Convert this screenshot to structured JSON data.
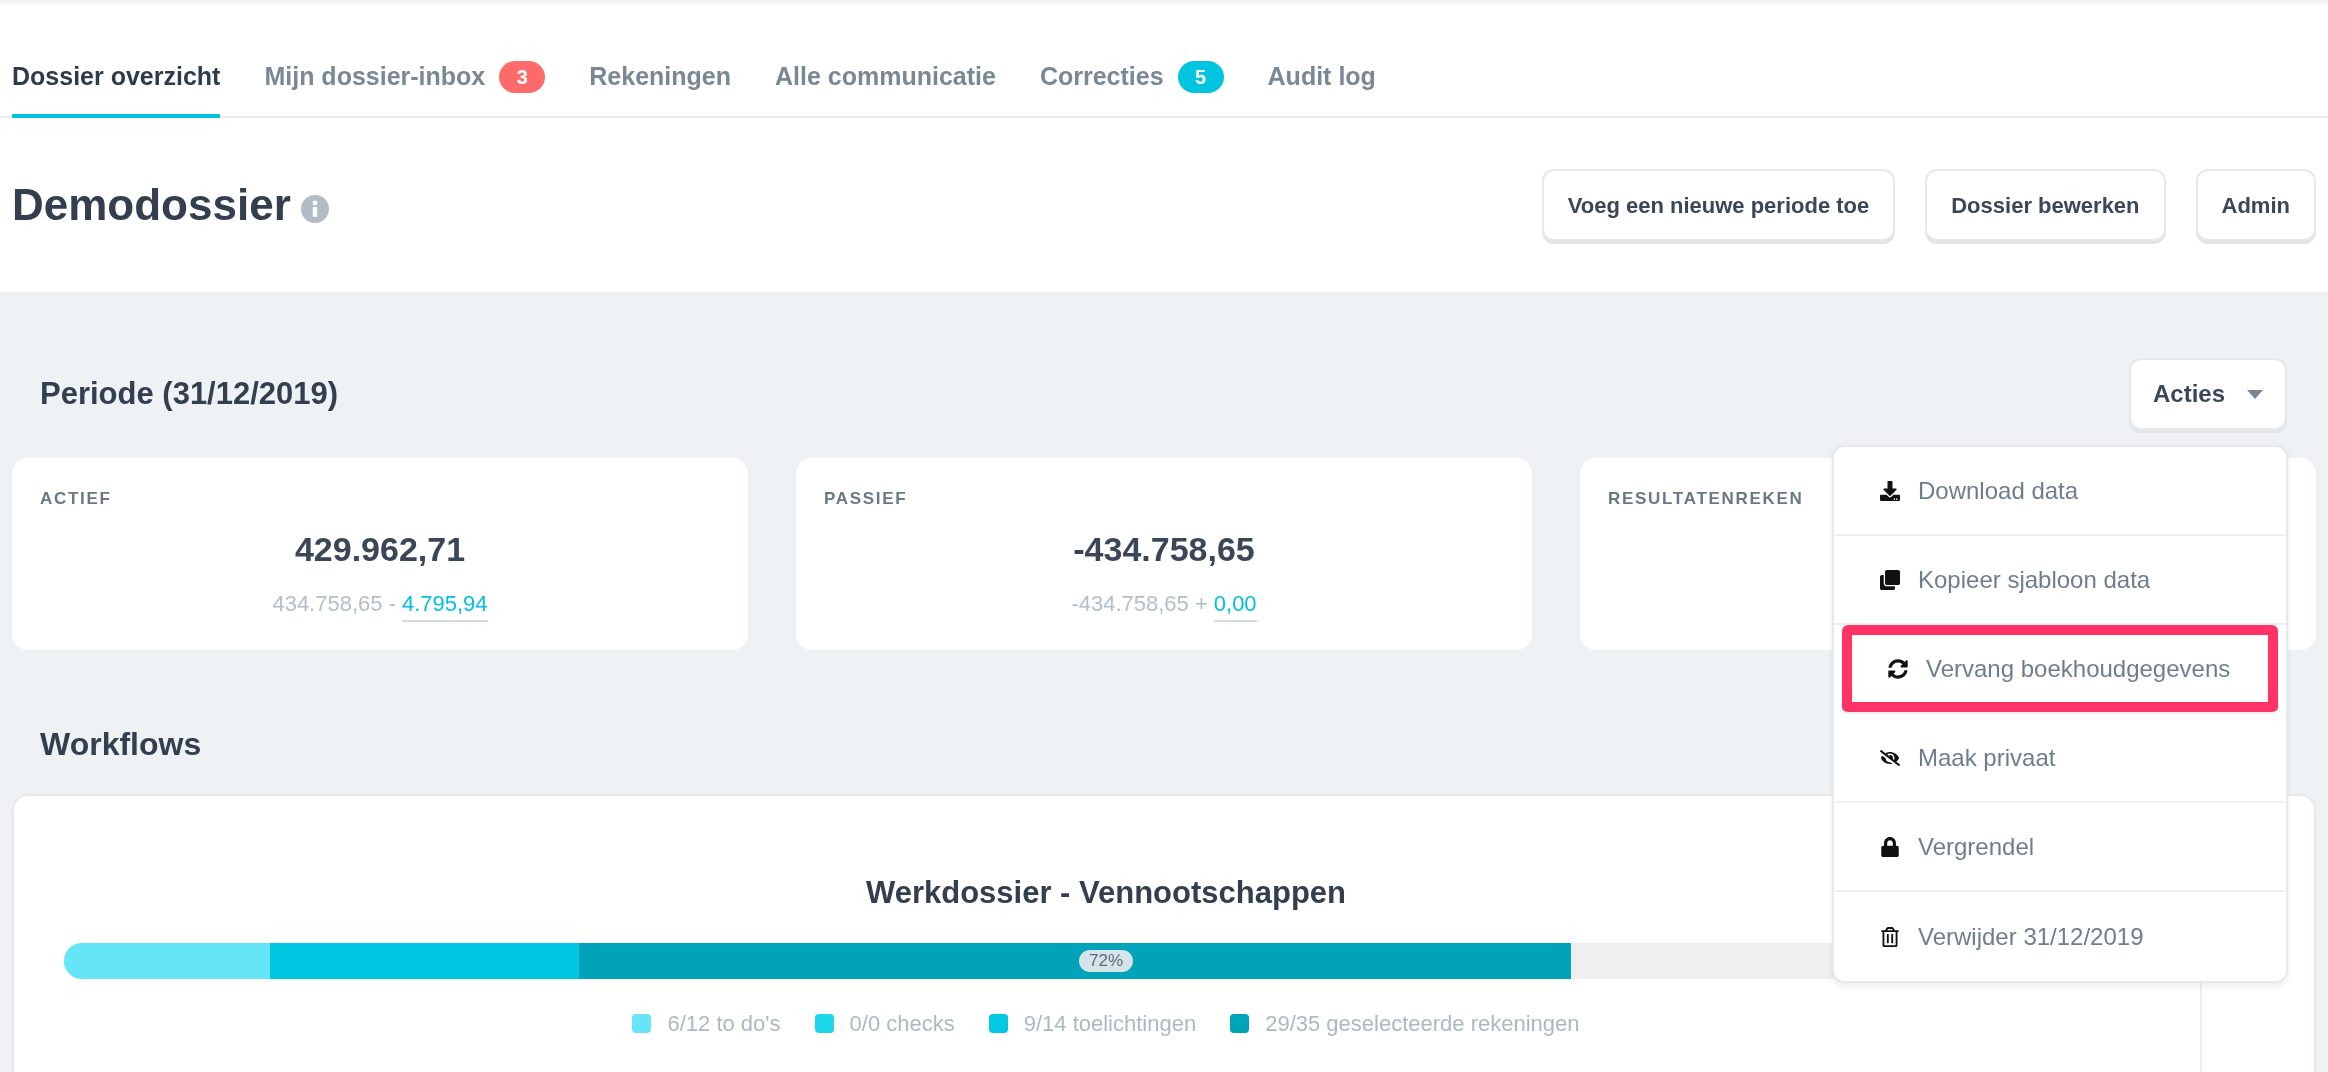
{
  "tabs": [
    {
      "label": "Dossier overzicht",
      "selected": true
    },
    {
      "label": "Mijn dossier-inbox",
      "selected": false,
      "badge": "3",
      "color": "#ff6b6b"
    },
    {
      "label": "Rekeningen",
      "selected": false
    },
    {
      "label": "Alle communicatie",
      "selected": false
    },
    {
      "label": "Correcties",
      "selected": false,
      "badge": "5",
      "color": "#00c4e0"
    },
    {
      "label": "Audit log",
      "selected": false
    }
  ],
  "header": {
    "title": "Demodossier",
    "buttons": [
      "Voeg een nieuwe periode toe",
      "Dossier bewerken",
      "Admin"
    ]
  },
  "period": {
    "title": "Periode (31/12/2019)",
    "actions_button": "Acties"
  },
  "cards": [
    {
      "label": "ACTIEF",
      "value": "429.962,71",
      "sub": "434.758,65 -",
      "link": "4.795,94"
    },
    {
      "label": "PASSIEF",
      "value": "-434.758,65",
      "sub": "-434.758,65 +",
      "link": "0,00"
    },
    {
      "label": "RESULTATENREKEN"
    }
  ],
  "workflows": {
    "title": "Workflows",
    "card_title": "Werkdossier - Vennootschappen",
    "progress_label": "72%",
    "segments": [
      {
        "legend": "6/12 to do's",
        "color": "#66e5f8",
        "level": 0.099
      },
      {
        "legend": "0/0 checks",
        "color": "#1ed6ea"
      },
      {
        "legend": "9/14 toelichtingen",
        "color": "#00c8e3",
        "level": 0.148
      },
      {
        "legend": "29/35 geselecteerde rekeningen",
        "color": "#00a3b8",
        "level": 0.476
      }
    ]
  },
  "menu": [
    {
      "label": "Download data",
      "highlighted": false
    },
    {
      "label": "Kopieer sjabloon data",
      "highlighted": false
    },
    {
      "label": "Vervang boekhoudgegevens",
      "highlighted": true
    },
    {
      "label": "Maak privaat",
      "highlighted": false
    },
    {
      "label": "Vergrendel",
      "highlighted": false
    },
    {
      "label": "Verwijder 31/12/2019",
      "highlighted": false
    }
  ]
}
